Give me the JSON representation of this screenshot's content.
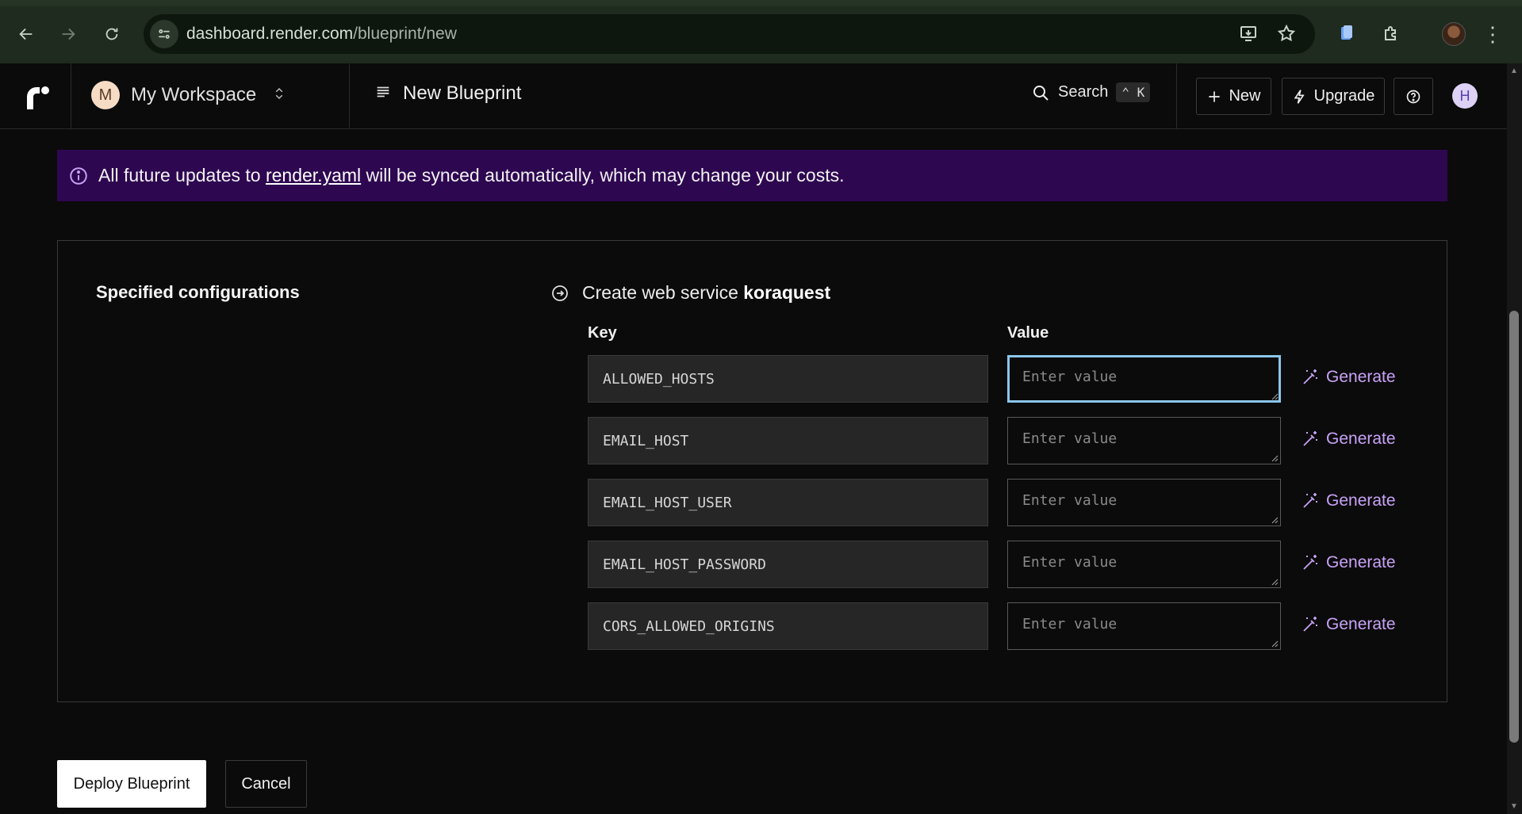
{
  "browser": {
    "url_host": "dashboard.render.com",
    "url_path": "/blueprint/new"
  },
  "header": {
    "workspace_initial": "M",
    "workspace_name": "My Workspace",
    "page_title": "New Blueprint",
    "search_label": "Search",
    "search_shortcut": "⌃ K",
    "new_label": "New",
    "upgrade_label": "Upgrade",
    "user_initial": "H"
  },
  "banner": {
    "text_before": "All future updates to ",
    "link_text": "render.yaml",
    "text_after": " will be synced automatically, which may change your costs.",
    "background": "#2e0751"
  },
  "config": {
    "section_label": "Specified configurations",
    "service_prefix": "Create web service ",
    "service_name": "koraquest",
    "key_header": "Key",
    "value_header": "Value",
    "value_placeholder": "Enter value",
    "generate_label": "Generate",
    "rows": [
      {
        "key": "ALLOWED_HOSTS"
      },
      {
        "key": "EMAIL_HOST"
      },
      {
        "key": "EMAIL_HOST_USER"
      },
      {
        "key": "EMAIL_HOST_PASSWORD"
      },
      {
        "key": "CORS_ALLOWED_ORIGINS"
      }
    ]
  },
  "actions": {
    "deploy_label": "Deploy Blueprint",
    "cancel_label": "Cancel"
  },
  "colors": {
    "accent_generate": "#c9a2f7",
    "focus_ring": "#8bc6ec"
  }
}
